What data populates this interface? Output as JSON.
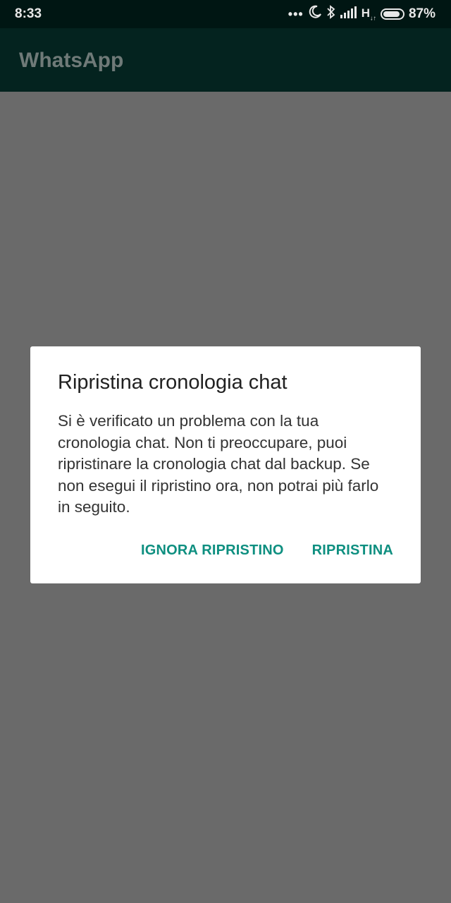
{
  "status_bar": {
    "time": "8:33",
    "icons": [
      "more-dots-icon",
      "moon-icon",
      "bluetooth-icon",
      "signal-icon"
    ],
    "network": "H",
    "network_sub": "↓↑",
    "battery_percent": "87%",
    "battery_level": 0.87
  },
  "app_bar": {
    "title": "WhatsApp"
  },
  "dialog": {
    "title": "Ripristina cronologia chat",
    "message": "Si è verificato un problema con la tua cronologia chat. Non ti preoccupare, puoi ripristinare la cronologia chat dal backup. Se non esegui il ripristino ora, non potrai più farlo in seguito.",
    "skip_label": "IGNORA RIPRISTINO",
    "restore_label": "RIPRISTINA"
  },
  "colors": {
    "status_bar": "#001613",
    "app_bar": "#04231f",
    "scrim": "#6a6a6a",
    "accent": "#0e8f80"
  }
}
